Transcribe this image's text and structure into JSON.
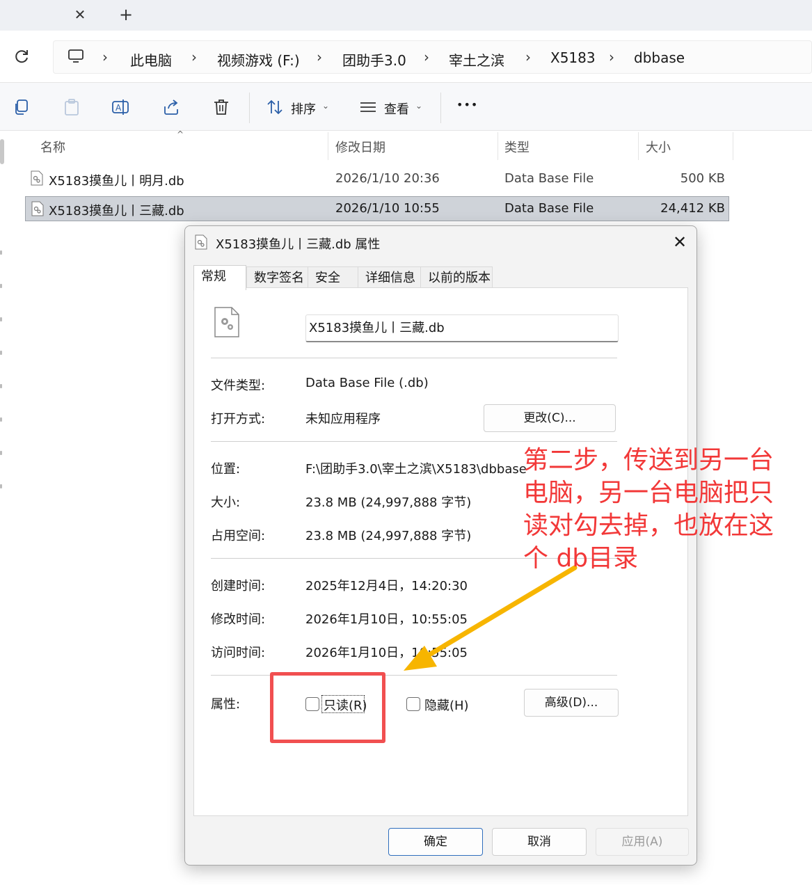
{
  "tabstrip": {
    "close_glyph": "✕",
    "new_glyph": "+"
  },
  "address": {
    "crumbs": [
      "此电脑",
      "视频游戏 (F:)",
      "团助手3.0",
      "宰土之滨",
      "X5183",
      "dbbase"
    ],
    "separator": "›"
  },
  "toolbar": {
    "sort_label": "排序",
    "view_label": "查看",
    "more_label": "•••",
    "chevron": "⌄",
    "icons": [
      "copy-icon",
      "paste-icon",
      "rename-icon",
      "share-icon",
      "delete-icon",
      "sort-icon",
      "view-icon"
    ]
  },
  "filelist": {
    "columns": {
      "name": "名称",
      "date": "修改日期",
      "type": "类型",
      "size": "大小"
    },
    "sort_caret": "^",
    "rows": [
      {
        "name": "X5183摸鱼儿丨明月.db",
        "date": "2026/1/10 20:36",
        "type": "Data Base File",
        "size": "500 KB",
        "selected": false
      },
      {
        "name": "X5183摸鱼儿丨三藏.db",
        "date": "2026/1/10 10:55",
        "type": "Data Base File",
        "size": "24,412 KB",
        "selected": true
      }
    ]
  },
  "dialog": {
    "title": "X5183摸鱼儿丨三藏.db 属性",
    "close_glyph": "✕",
    "tabs": [
      "常规",
      "数字签名",
      "安全",
      "详细信息",
      "以前的版本"
    ],
    "filename": "X5183摸鱼儿丨三藏.db",
    "file_type_label": "文件类型:",
    "file_type_value": "Data Base File (.db)",
    "opens_with_label": "打开方式:",
    "opens_with_value": "未知应用程序",
    "change_button": "更改(C)...",
    "location_label": "位置:",
    "location_value": "F:\\团助手3.0\\宰土之滨\\X5183\\dbbase",
    "size_label": "大小:",
    "size_value": "23.8 MB (24,997,888 字节)",
    "disk_label": "占用空间:",
    "disk_value": "23.8 MB (24,997,888 字节)",
    "created_label": "创建时间:",
    "created_value": "2025年12月4日，14:20:30",
    "modified_label": "修改时间:",
    "modified_value": "2026年1月10日，10:55:05",
    "accessed_label": "访问时间:",
    "accessed_value": "2026年1月10日，10:55:05",
    "attributes_label": "属性:",
    "readonly_label": "只读(R)",
    "readonly_checked": false,
    "hidden_label": "隐藏(H)",
    "hidden_checked": false,
    "advanced_button": "高级(D)...",
    "ok_button": "确定",
    "cancel_button": "取消",
    "apply_button": "应用(A)"
  },
  "annotation": {
    "note_lines": [
      "第二步，传送到另一台",
      "电脑，另一台电脑把只",
      "读对勾去掉，也放在这",
      "个 db目录"
    ],
    "red_color": "#f14f50",
    "arrow_color": "#f7b500"
  }
}
